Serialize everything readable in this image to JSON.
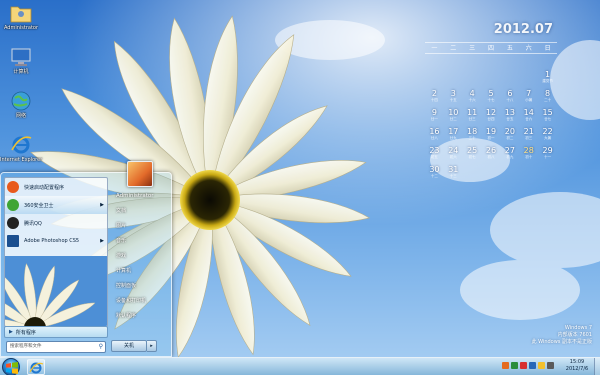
{
  "desktop_icons": [
    {
      "label": "Administrator",
      "icon": "user-folder-icon"
    },
    {
      "label": "计算机",
      "icon": "computer-icon"
    },
    {
      "label": "网络",
      "icon": "network-icon"
    },
    {
      "label": "Internet Explorer",
      "icon": "internet-explorer-icon"
    }
  ],
  "calendar": {
    "title": "2012.07",
    "weekdays": [
      "一",
      "二",
      "三",
      "四",
      "五",
      "六",
      "日"
    ],
    "weeks": [
      [
        {
          "n": "",
          "s": ""
        },
        {
          "n": "",
          "s": ""
        },
        {
          "n": "",
          "s": ""
        },
        {
          "n": "",
          "s": ""
        },
        {
          "n": "",
          "s": ""
        },
        {
          "n": "",
          "s": ""
        },
        {
          "n": "1",
          "s": "建党节"
        }
      ],
      [
        {
          "n": "2",
          "s": "十四"
        },
        {
          "n": "3",
          "s": "十五"
        },
        {
          "n": "4",
          "s": "十六"
        },
        {
          "n": "5",
          "s": "十七"
        },
        {
          "n": "6",
          "s": "十八"
        },
        {
          "n": "7",
          "s": "小暑"
        },
        {
          "n": "8",
          "s": "二十"
        }
      ],
      [
        {
          "n": "9",
          "s": "廿一"
        },
        {
          "n": "10",
          "s": "廿二"
        },
        {
          "n": "11",
          "s": "廿三"
        },
        {
          "n": "12",
          "s": "廿四"
        },
        {
          "n": "13",
          "s": "廿五"
        },
        {
          "n": "14",
          "s": "廿六"
        },
        {
          "n": "15",
          "s": "廿七"
        }
      ],
      [
        {
          "n": "16",
          "s": "廿八"
        },
        {
          "n": "17",
          "s": "廿九"
        },
        {
          "n": "18",
          "s": "三十"
        },
        {
          "n": "19",
          "s": "初一"
        },
        {
          "n": "20",
          "s": "初二"
        },
        {
          "n": "21",
          "s": "初三"
        },
        {
          "n": "22",
          "s": "大暑"
        }
      ],
      [
        {
          "n": "23",
          "s": "初五"
        },
        {
          "n": "24",
          "s": "初六"
        },
        {
          "n": "25",
          "s": "初七"
        },
        {
          "n": "26",
          "s": "初八"
        },
        {
          "n": "27",
          "s": "初九"
        },
        {
          "n": "28",
          "s": "初十"
        },
        {
          "n": "29",
          "s": "十一"
        }
      ],
      [
        {
          "n": "30",
          "s": "十二"
        },
        {
          "n": "31",
          "s": "十三"
        },
        {
          "n": "",
          "s": ""
        },
        {
          "n": "",
          "s": ""
        },
        {
          "n": "",
          "s": ""
        },
        {
          "n": "",
          "s": ""
        },
        {
          "n": "",
          "s": ""
        }
      ]
    ],
    "today": "28"
  },
  "start_menu": {
    "programs": [
      {
        "label": "快速启动配置程序",
        "icon": "config-icon",
        "color": "#e85a1c",
        "arrow": false
      },
      {
        "label": "360安全卫士",
        "icon": "shield-icon",
        "color": "#3fa535",
        "arrow": true
      },
      {
        "label": "腾讯QQ",
        "icon": "qq-penguin-icon",
        "color": "#222222",
        "arrow": false
      },
      {
        "label": "Adobe Photoshop CS5",
        "icon": "photoshop-icon",
        "color": "#1b4f8f",
        "arrow": true
      }
    ],
    "all_programs": "所有程序",
    "search_placeholder": "搜索程序和文件",
    "right_items": [
      "Administrator",
      "文档",
      "图片",
      "音乐",
      "游戏",
      "计算机",
      "控制面板",
      "设备和打印机",
      "默认程序"
    ],
    "shutdown": "关机",
    "shutdown_arrow": "▸"
  },
  "watermark": {
    "line1": "Windows 7",
    "line2": "内部版本 7601",
    "line3": "此 Windows 副本不是正版"
  },
  "taskbar": {
    "time": "15:09",
    "date": "2012/7/6",
    "tray_colors": [
      "#e46b1f",
      "#2a8d3c",
      "#d73030",
      "#2767b8",
      "#f2c12e",
      "#5a5a5a"
    ]
  }
}
